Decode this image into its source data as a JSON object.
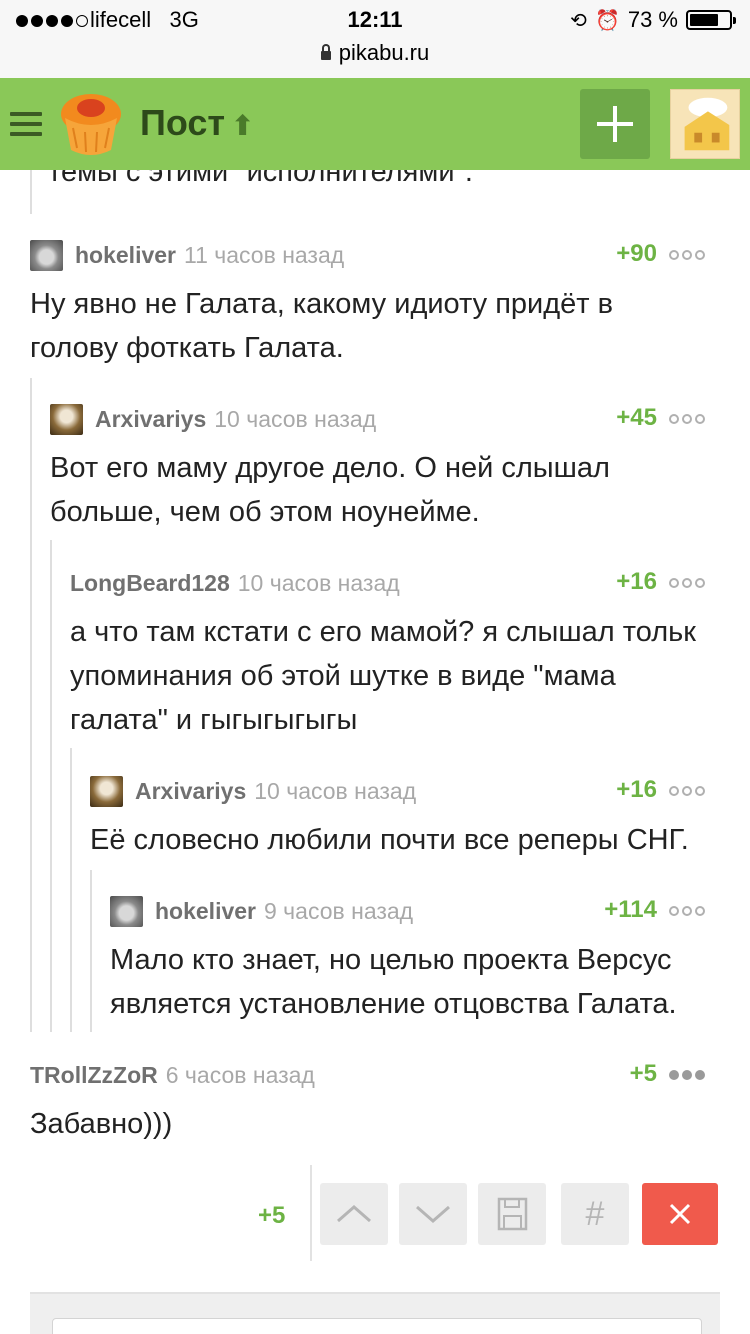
{
  "status": {
    "carrier": "lifecell",
    "network": "3G",
    "time": "12:11",
    "battery": "73 %",
    "battery_level": 0.73,
    "url": "pikabu.ru"
  },
  "nav": {
    "title": "Пост",
    "up_arrow": "🡅"
  },
  "previous_text": "темы с этими \"исполнителями\".",
  "comments": [
    {
      "author": "hokeliver",
      "time": "11 часов назад",
      "score": "+90",
      "text": "Ну явно не Галата, какому идиоту придёт в голову фоткать Галата.",
      "avatar": "cat"
    },
    {
      "author": "Arxivariys",
      "time": "10 часов назад",
      "score": "+45",
      "text": "Вот его маму другое дело. О ней слышал больше, чем об этом ноунейме.",
      "avatar": "wizard"
    },
    {
      "author": "LongBeard128",
      "time": "10 часов назад",
      "score": "+16",
      "text": "а что там кстати с его мамой? я слышал тольк упоминания об этой шутке в виде \"мама галата\" и гыгыгыгыгы",
      "avatar": ""
    },
    {
      "author": "Arxivariys",
      "time": "10 часов назад",
      "score": "+16",
      "text": "Её словесно любили почти все реперы СНГ.",
      "avatar": "wizard"
    },
    {
      "author": "hokeliver",
      "time": "9 часов назад",
      "score": "+114",
      "text": "Мало кто знает, но целью проекта Версус является установление отцовства Галата.",
      "avatar": "cat"
    },
    {
      "author": "TRollZzZoR",
      "time": "6 часов назад",
      "score": "+5",
      "text": "Забавно)))",
      "avatar": ""
    }
  ],
  "actions": {
    "score": "+5",
    "hash": "#"
  },
  "icons": {
    "menu": "hamburger-icon",
    "logo": "pikabu-cupcake-logo",
    "add": "plus-icon",
    "upvote": "chevron-up-icon",
    "downvote": "chevron-down-icon",
    "save": "floppy-disk-icon",
    "hash": "hash-icon",
    "close": "close-icon"
  },
  "colors": {
    "nav_bg": "#8ac858",
    "score": "#6db344",
    "close_button": "#f05a4c"
  }
}
